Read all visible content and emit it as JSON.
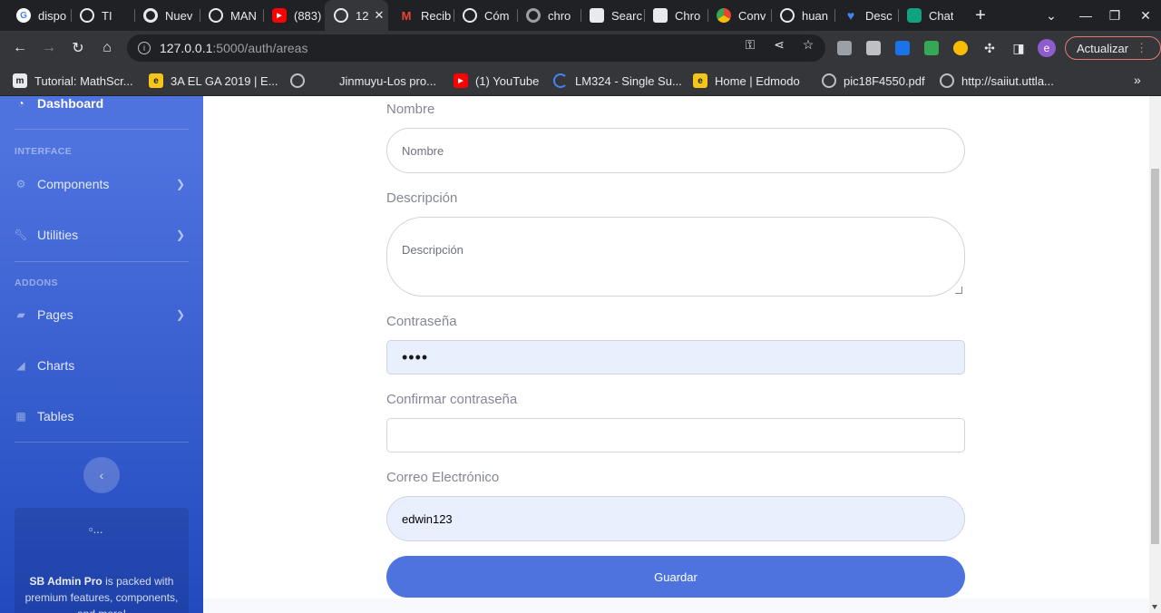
{
  "browser": {
    "tabs": [
      {
        "title": "dispo",
        "icon": "google-icon",
        "color": "#ffffff"
      },
      {
        "title": "TI",
        "icon": "globe-icon",
        "color": "#e8eaed"
      },
      {
        "title": "Nuev",
        "icon": "chrome-icon",
        "color": "#e8eaed"
      },
      {
        "title": "MAN",
        "icon": "globe-icon",
        "color": "#e8eaed"
      },
      {
        "title": "(883)",
        "icon": "youtube-icon",
        "color": "#ff0000"
      },
      {
        "title": "12",
        "icon": "globe-icon",
        "color": "#e8eaed",
        "active": true
      },
      {
        "title": "Recib",
        "icon": "gmail-icon",
        "color": "#ea4335"
      },
      {
        "title": "Cóm",
        "icon": "globe-icon",
        "color": "#e8eaed"
      },
      {
        "title": "chro",
        "icon": "chrome-icon",
        "color": "#9aa0a6"
      },
      {
        "title": "Searc",
        "icon": "store-icon",
        "color": "#e8eaed"
      },
      {
        "title": "Chro",
        "icon": "store-icon",
        "color": "#e8eaed"
      },
      {
        "title": "Conv",
        "icon": "chrome-color-icon",
        "color": "#fbbc04"
      },
      {
        "title": "huan",
        "icon": "globe-icon",
        "color": "#e8eaed"
      },
      {
        "title": "Desc",
        "icon": "heart-icon",
        "color": "#4285f4"
      },
      {
        "title": "Chat",
        "icon": "chatgpt-icon",
        "color": "#10a37f"
      }
    ],
    "address": {
      "host": "127.0.0.1",
      "path": ":5000/auth/areas"
    },
    "update_label": "Actualizar",
    "profile_initial": "e",
    "bookmarks": [
      {
        "label": "Tutorial: MathScr...",
        "icon": "mathscribe-icon"
      },
      {
        "label": "3A EL GA 2019 | E...",
        "icon": "edmodo-icon"
      },
      {
        "label": "",
        "icon": "globe-icon"
      },
      {
        "label": "Jinmuyu-Los pro...",
        "icon": "none"
      },
      {
        "label": "(1) YouTube",
        "icon": "youtube-icon"
      },
      {
        "label": "LM324 - Single Su...",
        "icon": "loading-icon"
      },
      {
        "label": "Home | Edmodo",
        "icon": "edmodo-icon"
      },
      {
        "label": "pic18F4550.pdf",
        "icon": "globe-icon"
      },
      {
        "label": "http://saiiut.uttla...",
        "icon": "globe-icon"
      }
    ]
  },
  "sidebar": {
    "dashboard": "Dashboard",
    "heading_interface": "INTERFACE",
    "heading_addons": "ADDONS",
    "items": [
      {
        "label": "Components",
        "icon": "cog-icon",
        "chevron": true
      },
      {
        "label": "Utilities",
        "icon": "wrench-icon",
        "chevron": true
      },
      {
        "label": "Pages",
        "icon": "folder-icon",
        "chevron": true
      },
      {
        "label": "Charts",
        "icon": "chart-area-icon",
        "chevron": false
      },
      {
        "label": "Tables",
        "icon": "table-icon",
        "chevron": false
      }
    ],
    "card": {
      "image_alt": "...",
      "brand": "SB Admin Pro",
      "text": " is packed with premium features, components, and more!"
    }
  },
  "form": {
    "nombre": {
      "label": "Nombre",
      "placeholder": "Nombre"
    },
    "descripcion": {
      "label": "Descripción",
      "placeholder": "Descripción"
    },
    "contrasena": {
      "label": "Contraseña",
      "value": "••••"
    },
    "confirmar": {
      "label": "Confirmar contraseña",
      "value": ""
    },
    "correo": {
      "label": "Correo Electrónico",
      "value": "edwin123"
    },
    "submit": "Guardar"
  },
  "colors": {
    "primary": "#4e73df",
    "autofill": "#e8f0fe"
  }
}
